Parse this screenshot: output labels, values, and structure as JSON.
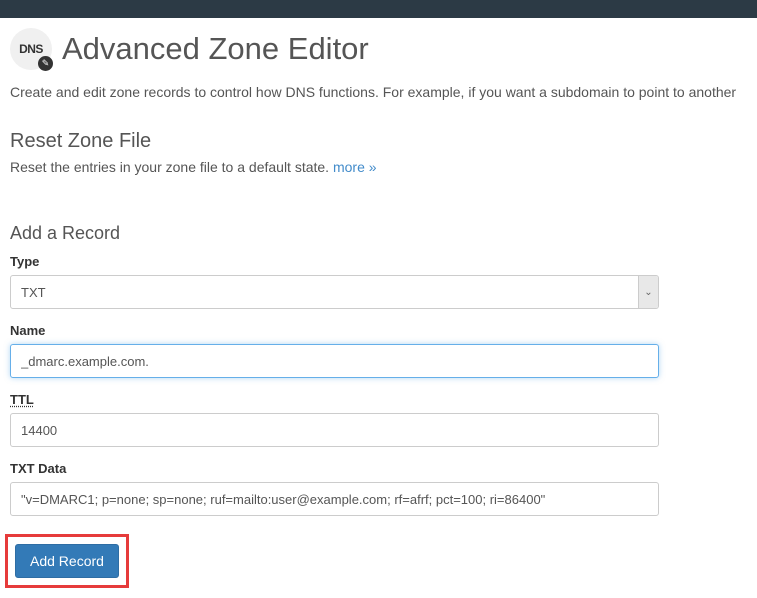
{
  "header": {
    "icon_text": "DNS",
    "title": "Advanced Zone Editor"
  },
  "intro_text": "Create and edit zone records to control how DNS functions. For example, if you want a subdomain to point to another ",
  "reset_zone": {
    "heading": "Reset Zone File",
    "description": "Reset the entries in your zone file to a default state. ",
    "more_label": "more »"
  },
  "add_record": {
    "heading": "Add a Record",
    "type_label": "Type",
    "type_value": "TXT",
    "name_label": "Name",
    "name_value": "_dmarc.example.com.",
    "ttl_label": "TTL",
    "ttl_value": "14400",
    "txtdata_label": "TXT Data",
    "txtdata_value": "\"v=DMARC1; p=none; sp=none; ruf=mailto:user@example.com; rf=afrf; pct=100; ri=86400\"",
    "submit_label": "Add Record"
  }
}
